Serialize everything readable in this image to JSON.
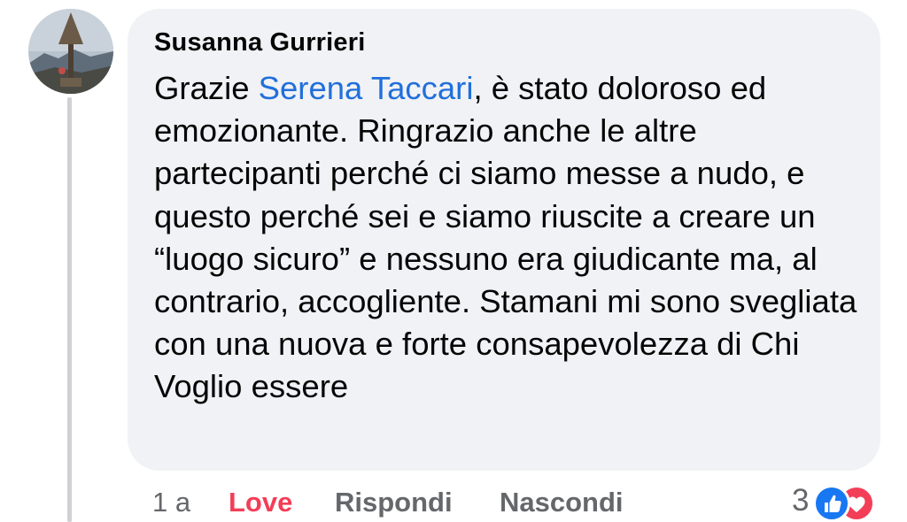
{
  "comment": {
    "author": "Susanna Gurrieri",
    "text_before_mention": "Grazie ",
    "mention": "Serena Taccari",
    "text_after_mention": ", è stato doloroso ed emozionante. Ringrazio anche le altre partecipanti perché ci siamo messe a nudo, e questo perché sei e siamo riuscite a creare un “luogo sicuro” e nessuno era giudicante ma, al contrario, accogliente. Stamani mi sono svegliata con una nuova e forte consapevolezza di Chi Voglio essere"
  },
  "actions": {
    "time": "1 a",
    "love_label": "Love",
    "reply_label": "Rispondi",
    "hide_label": "Nascondi"
  },
  "reactions": {
    "count": "3",
    "icons": [
      "like-icon",
      "love-icon"
    ]
  },
  "colors": {
    "bubble_background": "#f0f2f5",
    "mention": "#216fdb",
    "love": "#f33e58",
    "like": "#1877f2",
    "secondary_text": "#65676b"
  }
}
